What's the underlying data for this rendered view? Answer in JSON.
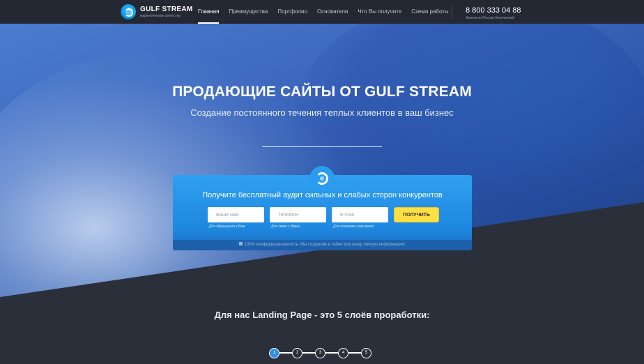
{
  "header": {
    "logo_title": "GULF STREAM",
    "logo_subtitle": "маркетинговое агентство",
    "nav": [
      "Главная",
      "Преимущества",
      "Портфолио",
      "Основатели",
      "Что Вы получите",
      "Схема работы"
    ],
    "active_nav": "Главная",
    "phone": "8 800 333 04 88",
    "phone_note": "Звонок по России бесплатный"
  },
  "hero": {
    "title": "ПРОДАЮЩИЕ САЙТЫ ОТ GULF STREAM",
    "subtitle": "Создание постоянного течения теплых клиентов в ваш бизнес"
  },
  "form": {
    "title": "Получите бесплатный аудит сильных и слабых сторон конкурентов",
    "fields": [
      {
        "placeholder": "Ваше имя",
        "hint": "Для обращения к Вам"
      },
      {
        "placeholder": "Телефон",
        "hint": "Для связи с Вами"
      },
      {
        "placeholder": "E-mail",
        "hint": "Для отправки ком.предл."
      }
    ],
    "submit_label": "ПОЛУЧИТЬ",
    "privacy": "100% конфиденциальность. Мы сохраним в тайне всю вашу личную информацию."
  },
  "section": {
    "title": "Для нас Landing Page - это 5 слоёв проработки:",
    "steps": [
      "1",
      "2",
      "3",
      "4",
      "5"
    ],
    "active_step": "1"
  },
  "colors": {
    "header_bg": "#232832",
    "accent_blue": "#2f9aef",
    "button_yellow": "#ffe042",
    "dark_bg": "#2a2f3a"
  }
}
